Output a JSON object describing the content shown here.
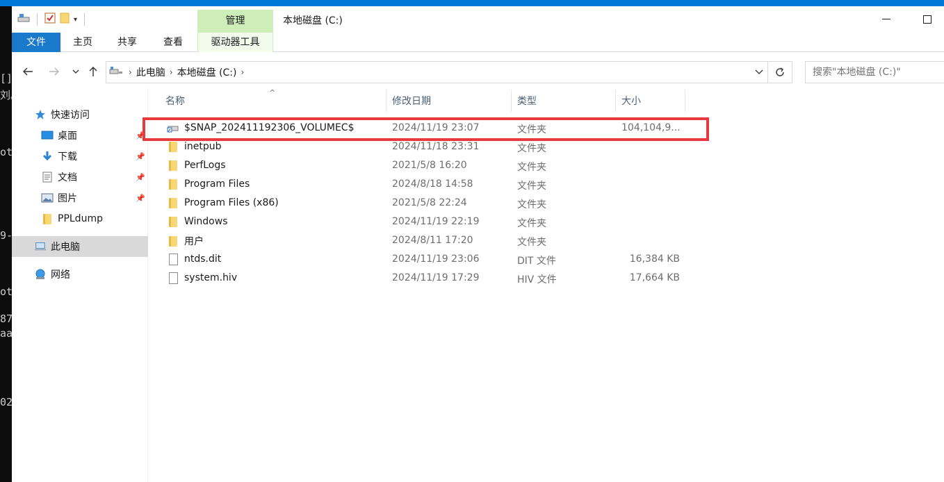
{
  "console": {
    "lines": [
      "[]",
      "刘。",
      "ot",
      "9-",
      "ot",
      "87",
      "aa",
      "02"
    ]
  },
  "window": {
    "title": "本地磁盘 (C:)",
    "context_group": "管理",
    "tabs": [
      {
        "label": "文件"
      },
      {
        "label": "主页"
      },
      {
        "label": "共享"
      },
      {
        "label": "查看"
      },
      {
        "label": "驱动器工具"
      }
    ]
  },
  "address": {
    "crumbs": [
      "此电脑",
      "本地磁盘 (C:)"
    ],
    "search_placeholder": "搜索\"本地磁盘 (C:)\""
  },
  "sidebar": {
    "items": [
      {
        "label": "快速访问",
        "icon": "star-icon"
      },
      {
        "label": "桌面",
        "icon": "desktop-icon",
        "pinned": true
      },
      {
        "label": "下载",
        "icon": "download-icon",
        "pinned": true
      },
      {
        "label": "文档",
        "icon": "document-icon",
        "pinned": true
      },
      {
        "label": "图片",
        "icon": "picture-icon",
        "pinned": true
      },
      {
        "label": "PPLdump",
        "icon": "folder-icon"
      },
      {
        "label": "此电脑",
        "icon": "computer-icon",
        "selected": true
      },
      {
        "label": "网络",
        "icon": "network-icon"
      }
    ]
  },
  "columns": {
    "name": "名称",
    "date": "修改日期",
    "type": "类型",
    "size": "大小"
  },
  "files": [
    {
      "name": "$SNAP_202411192306_VOLUMEC$",
      "date": "2024/11/19 23:07",
      "type": "文件夹",
      "size": "104,104,9...",
      "icon": "shortcut-drive-icon",
      "highlighted": true
    },
    {
      "name": "inetpub",
      "date": "2024/11/18 23:31",
      "type": "文件夹",
      "size": "",
      "icon": "folder-icon"
    },
    {
      "name": "PerfLogs",
      "date": "2021/5/8 16:20",
      "type": "文件夹",
      "size": "",
      "icon": "folder-icon"
    },
    {
      "name": "Program Files",
      "date": "2024/8/18 14:58",
      "type": "文件夹",
      "size": "",
      "icon": "folder-icon"
    },
    {
      "name": "Program Files (x86)",
      "date": "2021/5/8 22:24",
      "type": "文件夹",
      "size": "",
      "icon": "folder-icon"
    },
    {
      "name": "Windows",
      "date": "2024/11/19 22:19",
      "type": "文件夹",
      "size": "",
      "icon": "folder-icon"
    },
    {
      "name": "用户",
      "date": "2024/8/11 17:20",
      "type": "文件夹",
      "size": "",
      "icon": "folder-icon"
    },
    {
      "name": "ntds.dit",
      "date": "2024/11/19 23:06",
      "type": "DIT 文件",
      "size": "16,384 KB",
      "icon": "file-icon"
    },
    {
      "name": "system.hiv",
      "date": "2024/11/19 17:29",
      "type": "HIV 文件",
      "size": "17,664 KB",
      "icon": "file-icon"
    }
  ],
  "colors": {
    "accent": "#0078d7",
    "file_tab": "#1979ca",
    "context_tab": "#cdeeb9",
    "highlight_border": "#e8393e"
  }
}
